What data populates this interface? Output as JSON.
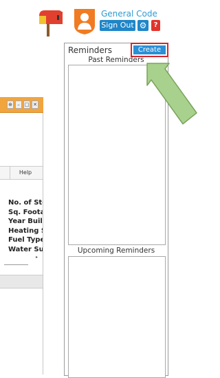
{
  "header": {
    "brand_name": "General Code",
    "signout_label": "Sign Out",
    "help_icon_label": "?",
    "colors": {
      "brand_blue": "#1f86c8",
      "help_red": "#e2332c",
      "mailbox_red": "#e1402f",
      "shield_orange": "#f07b22"
    }
  },
  "dialog": {
    "title_buttons": [
      "⊕",
      "–",
      "□",
      "✕"
    ],
    "help_tab_label": "Help",
    "fields": [
      "No. of Sto",
      "Sq. Footag",
      "Year Built",
      "Heating S",
      "Fuel Type",
      "Water Sup"
    ],
    "expand_arrow": "▸",
    "colors": {
      "title_bar": "#f2a43d"
    }
  },
  "reminders": {
    "title": "Reminders",
    "create_label": "Create",
    "past_label": "Past Reminders",
    "upcoming_label": "Upcoming Reminders",
    "colors": {
      "create_button": "#2b8fd6",
      "highlight_border": "#d6262a"
    }
  },
  "annotation": {
    "arrow_color": "#a9d18e",
    "arrow_stroke": "#7aa35a"
  }
}
